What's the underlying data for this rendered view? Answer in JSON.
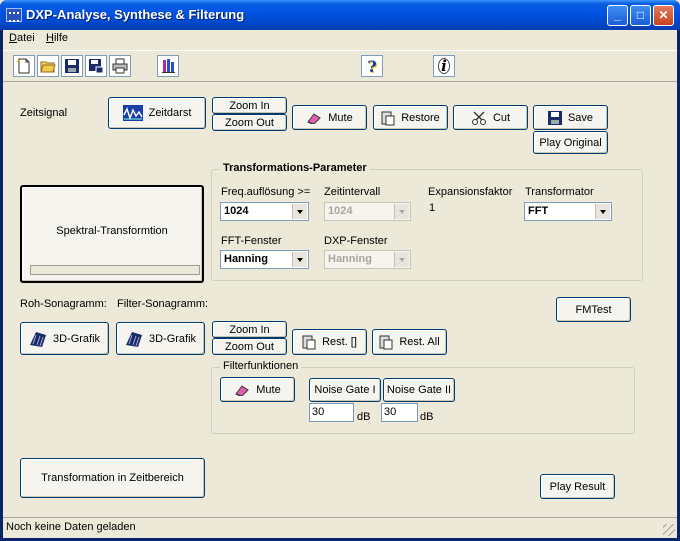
{
  "window": {
    "title": "DXP-Analyse, Synthese & Filterung",
    "minimize": "_",
    "maximize": "□",
    "close": "✕"
  },
  "menu": {
    "items": [
      {
        "label": "Datei",
        "underline": "D"
      },
      {
        "label": "Hilfe",
        "underline": "H"
      }
    ]
  },
  "toolbar": {
    "help_label": "?",
    "info_label": "i"
  },
  "zeit": {
    "label": "Zeitsignal",
    "zeitdarst": "Zeitdarst",
    "zoom_in": "Zoom In",
    "zoom_out": "Zoom Out",
    "mute": "Mute",
    "restore": "Restore",
    "cut": "Cut",
    "save": "Save",
    "play_original": "Play Original"
  },
  "spektral": {
    "label": "Spektral-Transformtion"
  },
  "params": {
    "title": "Transformations-Parameter",
    "freq_label": "Freq.auflösung  >=",
    "freq_value": "1024",
    "zeit_label": "Zeitintervall",
    "zeit_value": "1024",
    "exp_label": "Expansionsfaktor",
    "exp_value": "1",
    "trans_label": "Transformator",
    "trans_value": "FFT",
    "fft_label": "FFT-Fenster",
    "fft_value": "Hanning",
    "dxp_label": "DXP-Fenster",
    "dxp_value": "Hanning"
  },
  "sono": {
    "roh_label": "Roh-Sonagramm:",
    "filter_label": "Filter-Sonagramm:",
    "grafik_1": "3D-Grafik",
    "grafik_2": "3D-Grafik",
    "zoom_in": "Zoom In",
    "zoom_out": "Zoom Out",
    "rest": "Rest. []",
    "rest_all": "Rest. All",
    "fmtest": "FMTest"
  },
  "filter": {
    "title": "Filterfunktionen",
    "mute": "Mute",
    "gate1": "Noise Gate I",
    "gate2": "Noise Gate II",
    "gate1_value": "30",
    "gate2_value": "30",
    "unit1": "dB",
    "unit2": "dB"
  },
  "bottom": {
    "transform_back": "Transformation in Zeitbereich",
    "play_result": "Play Result"
  },
  "status": {
    "text": "Noch keine Daten geladen"
  }
}
